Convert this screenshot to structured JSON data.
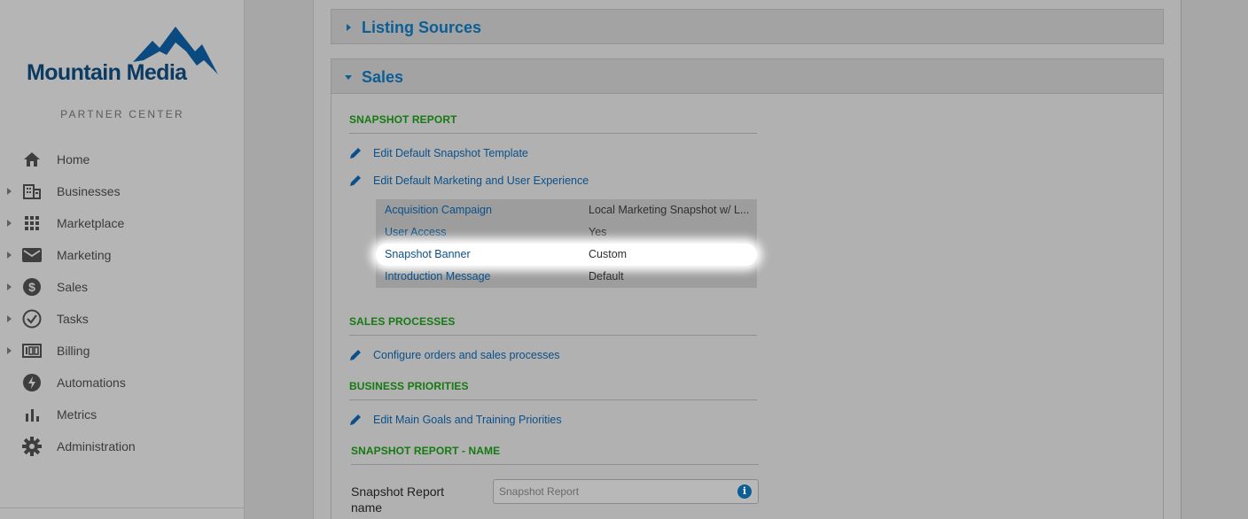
{
  "brand": {
    "logo_text": "Mountain Media",
    "subtitle": "PARTNER CENTER"
  },
  "sidebar": {
    "items": [
      {
        "label": "Home",
        "icon": "home-icon",
        "expandable": false
      },
      {
        "label": "Businesses",
        "icon": "building-icon",
        "expandable": true
      },
      {
        "label": "Marketplace",
        "icon": "grid-icon",
        "expandable": true
      },
      {
        "label": "Marketing",
        "icon": "envelope-icon",
        "expandable": true
      },
      {
        "label": "Sales",
        "icon": "dollar-icon",
        "expandable": true
      },
      {
        "label": "Tasks",
        "icon": "check-circle-icon",
        "expandable": true
      },
      {
        "label": "Billing",
        "icon": "billing-icon",
        "expandable": true
      },
      {
        "label": "Automations",
        "icon": "bolt-icon",
        "expandable": false
      },
      {
        "label": "Metrics",
        "icon": "bar-chart-icon",
        "expandable": false
      },
      {
        "label": "Administration",
        "icon": "gear-icon",
        "expandable": false
      }
    ]
  },
  "panels": {
    "listing_sources": {
      "title": "Listing Sources",
      "expanded": false
    },
    "sales": {
      "title": "Sales",
      "expanded": true
    }
  },
  "sales": {
    "snapshot_report": {
      "title": "SNAPSHOT REPORT",
      "links": [
        "Edit Default Snapshot Template",
        "Edit Default Marketing and User Experience"
      ],
      "table": [
        {
          "key": "Acquisition Campaign",
          "value": "Local Marketing Snapshot w/ L..."
        },
        {
          "key": "User Access",
          "value": "Yes"
        },
        {
          "key": "Snapshot Banner",
          "value": "Custom"
        },
        {
          "key": "Introduction Message",
          "value": "Default"
        }
      ]
    },
    "sales_processes": {
      "title": "SALES PROCESSES",
      "link": "Configure orders and sales processes"
    },
    "business_priorities": {
      "title": "BUSINESS PRIORITIES",
      "link": "Edit Main Goals and Training Priorities"
    },
    "snapshot_name": {
      "title": "SNAPSHOT REPORT - NAME",
      "field_label": "Snapshot Report name",
      "placeholder": "Snapshot Report"
    }
  },
  "colors": {
    "accent": "#0b5e96",
    "section_green": "#157a12",
    "brand_navy": "#0b3a63"
  }
}
